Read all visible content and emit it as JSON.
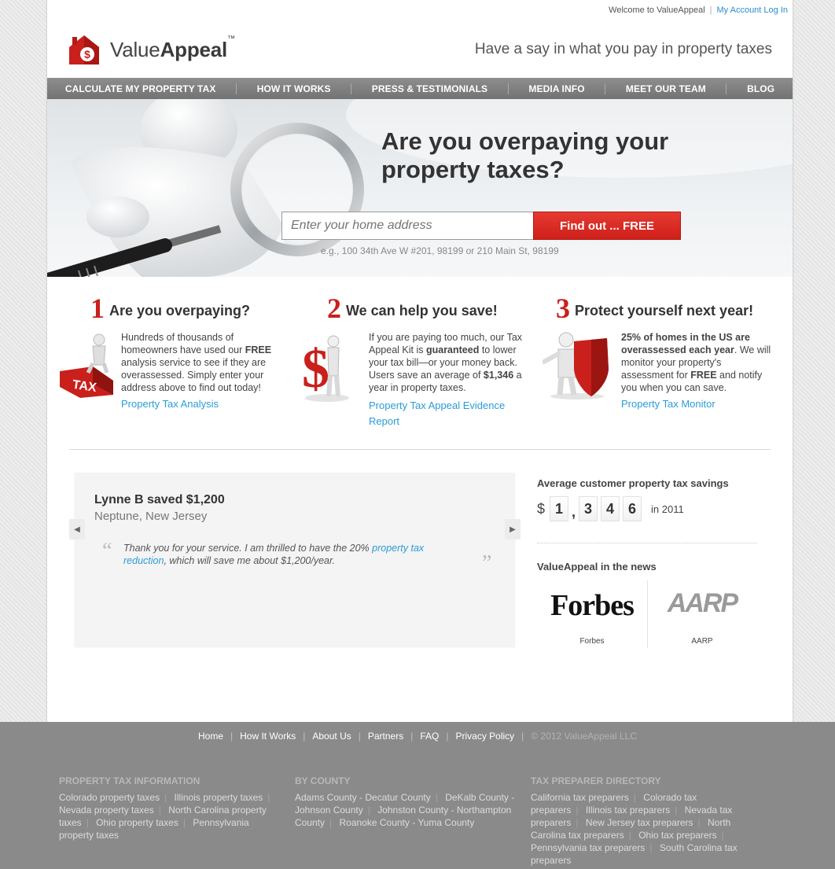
{
  "topbar": {
    "welcome": "Welcome to ValueAppeal",
    "sep": "|",
    "account": "My Account Log In"
  },
  "logo": {
    "text_plain": "Value",
    "text_bold": "Appeal",
    "tm": "™"
  },
  "tagline": "Have a say in what you pay in property taxes",
  "nav": [
    "CALCULATE MY PROPERTY TAX",
    "HOW IT WORKS",
    "PRESS & TESTIMONIALS",
    "MEDIA INFO",
    "MEET OUR TEAM",
    "BLOG"
  ],
  "hero": {
    "title": "Are you overpaying your property taxes?",
    "placeholder": "Enter your home address",
    "button": "Find out ... FREE",
    "example": "e.g., 100 34th Ave W #201, 98199 or 210 Main St, 98199"
  },
  "features": [
    {
      "num": "1",
      "title": "Are you overpaying?",
      "body": "Hundreds of thousands of homeowners have used our FREE analysis service to see if they are overassessed. Simply enter your address above to find out today!",
      "link": "Property Tax Analysis"
    },
    {
      "num": "2",
      "title": "We can help you save!",
      "body": "If you are paying too much, our Tax Appeal Kit is guaranteed to lower your tax bill—or your money back. Users save an average of $1,346 a year in property taxes.",
      "link": "Property Tax Appeal Evidence Report"
    },
    {
      "num": "3",
      "title": "Protect yourself next year!",
      "body": "25% of homes in the US are overassessed each year. We will monitor your property's assessment for FREE and notify you when you can save.",
      "link": "Property Tax Monitor"
    }
  ],
  "testimonial": {
    "who": "Lynne B saved $1,200",
    "where": "Neptune, New Jersey",
    "quote_pre": "Thank you for your service. I am thrilled to have the 20% ",
    "quote_link": "property tax reduction",
    "quote_post": ", which will save me about $1,200/year.",
    "open_quote": "“",
    "close_quote": "”",
    "prev": "◀",
    "next": "▶"
  },
  "savings": {
    "title": "Average customer property tax savings",
    "currency": "$",
    "digits": [
      "1",
      "3",
      "4",
      "6"
    ],
    "comma": ",",
    "year": "in 2011"
  },
  "news": {
    "title": "ValueAppeal in the news",
    "items": [
      {
        "logo": "Forbes",
        "caption": "Forbes"
      },
      {
        "logo": "AARP",
        "caption": "AARP"
      }
    ]
  },
  "footer": {
    "links": [
      "Home",
      "How It Works",
      "About Us",
      "Partners",
      "FAQ",
      "Privacy Policy"
    ],
    "copyright": "© 2012 ValueAppeal LLC",
    "columns": [
      {
        "heading": "PROPERTY TAX INFORMATION",
        "items": [
          "Colorado property taxes",
          "Illinois property taxes",
          "Nevada property taxes",
          "North Carolina property taxes",
          "Ohio property taxes",
          "Pennsylvania property taxes"
        ]
      },
      {
        "heading": "BY COUNTY",
        "items": [
          "Adams County - Decatur County",
          "DeKalb County - Johnson County",
          "Johnston County - Northampton County",
          "Roanoke County - Yuma County"
        ]
      },
      {
        "heading": "TAX PREPARER DIRECTORY",
        "items": [
          "California tax preparers",
          "Colorado tax preparers",
          "Illinois tax preparers",
          "Nevada tax preparers",
          "New Jersey tax preparers",
          "North Carolina tax preparers",
          "Ohio tax preparers",
          "Pennsylvania tax preparers",
          "South Carolina tax preparers"
        ]
      }
    ]
  },
  "colors": {
    "accent_red": "#cf1f1a",
    "link_blue": "#2a9cd6",
    "nav_gray": "#808080",
    "footer_gray": "#8a8a8a"
  },
  "icons": [
    "house-dollar-logo-icon",
    "magnifier-figure-illustration",
    "tax-figure-icon",
    "dollar-figure-icon",
    "shield-figure-icon",
    "chevron-left-icon",
    "chevron-right-icon"
  ]
}
